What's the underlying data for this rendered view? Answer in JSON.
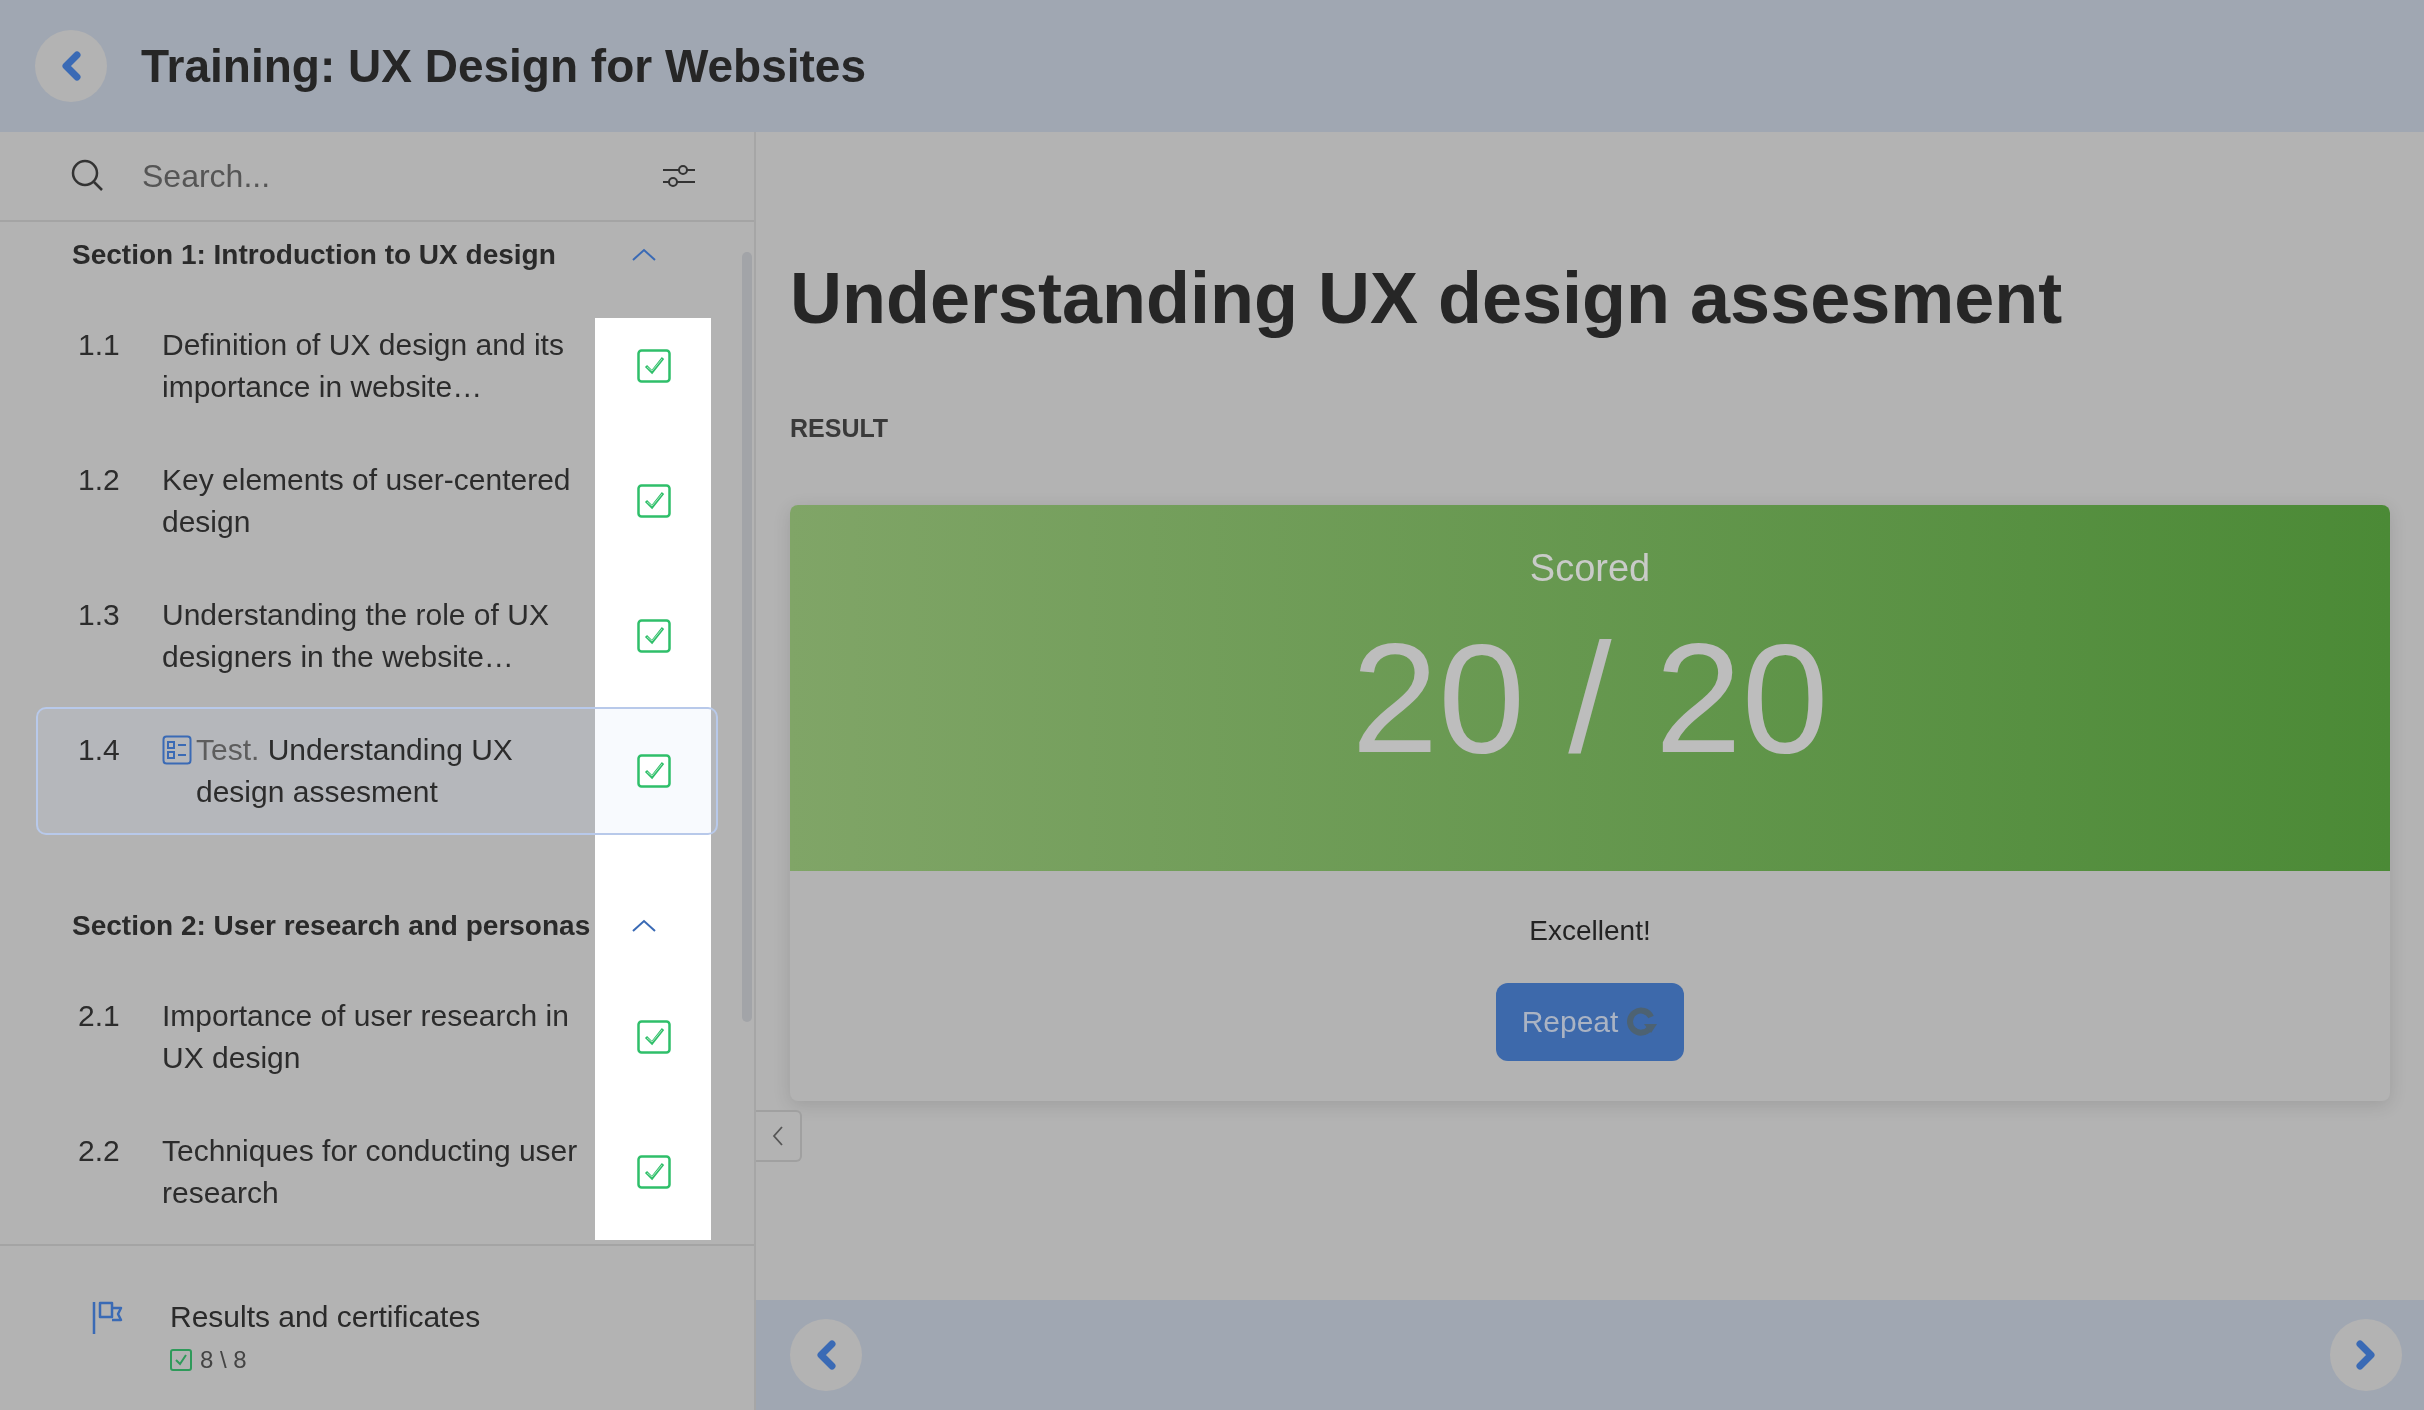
{
  "header": {
    "title": "Training: UX Design for Websites"
  },
  "search": {
    "placeholder": "Search..."
  },
  "sections": [
    {
      "title": "Section 1: Introduction to UX design",
      "expanded": true,
      "lessons": [
        {
          "number": "1.1",
          "kind": "lesson",
          "title": "Definition of UX design and its importance in website…",
          "checked": true,
          "selected": false
        },
        {
          "number": "1.2",
          "kind": "lesson",
          "title": "Key elements of user-centered design",
          "checked": true,
          "selected": false
        },
        {
          "number": "1.3",
          "kind": "lesson",
          "title": "Understanding the role of UX designers in the website…",
          "checked": true,
          "selected": false
        },
        {
          "number": "1.4",
          "kind": "test",
          "prefix": "Test.",
          "title": "Understanding UX design assesment",
          "checked": true,
          "selected": true
        }
      ]
    },
    {
      "title": "Section 2: User research and personas",
      "expanded": true,
      "lessons": [
        {
          "number": "2.1",
          "kind": "lesson",
          "title": "Importance of user research in UX design",
          "checked": true,
          "selected": false
        },
        {
          "number": "2.2",
          "kind": "lesson",
          "title": "Techniques for conducting user research",
          "checked": true,
          "selected": false
        }
      ]
    }
  ],
  "results_link": {
    "title": "Results and certificates",
    "progress": "8 \\ 8",
    "complete": true
  },
  "main": {
    "title": "Understanding UX design assesment",
    "label": "RESULT",
    "score_label": "Scored",
    "score": "20 / 20",
    "verdict": "Excellent!",
    "repeat_button": "Repeat"
  }
}
